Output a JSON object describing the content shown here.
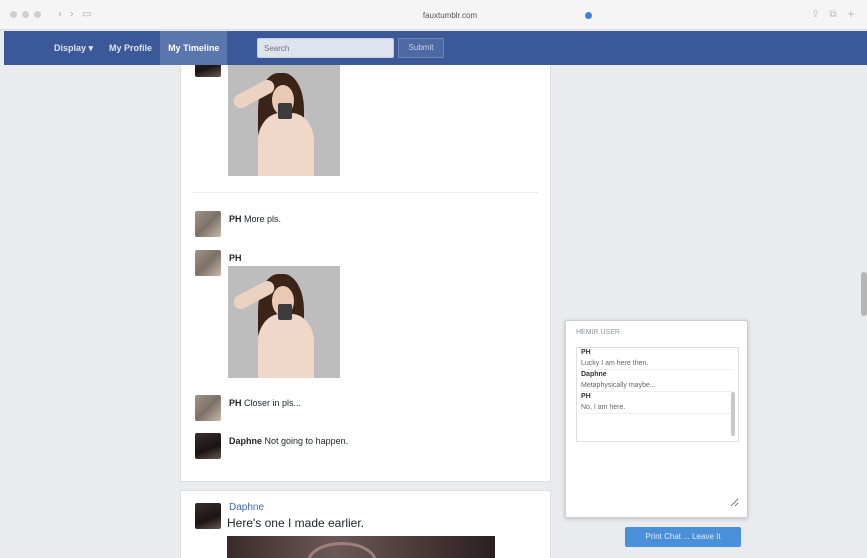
{
  "browser": {
    "url": "fauxtumblr.com",
    "back_icon": "back-arrow-icon",
    "forward_icon": "forward-arrow-icon"
  },
  "navbar": {
    "items": [
      {
        "label": "Display ▾",
        "active": false
      },
      {
        "label": "My Profile",
        "active": false
      },
      {
        "label": "My Timeline",
        "active": true
      }
    ],
    "search_placeholder": "Search",
    "search_button": "Submit"
  },
  "feed": {
    "messages": [
      {
        "author": "PH",
        "text": "More pls."
      },
      {
        "author": "PH",
        "text": ""
      },
      {
        "author": "PH",
        "text": "Closer in pls..."
      },
      {
        "author": "Daphne",
        "text": "Not going to happen."
      }
    ]
  },
  "post": {
    "author": "Daphne",
    "text": "Here's one I made earlier."
  },
  "chat": {
    "header": "HEMIR USER",
    "log": [
      {
        "who": "PH",
        "text": "Lucky I am here then."
      },
      {
        "who": "Daphne",
        "text": "Metaphysically maybe..."
      },
      {
        "who": "PH",
        "text": "No, I am here."
      }
    ],
    "button": "Print Chat ... Leave It"
  }
}
